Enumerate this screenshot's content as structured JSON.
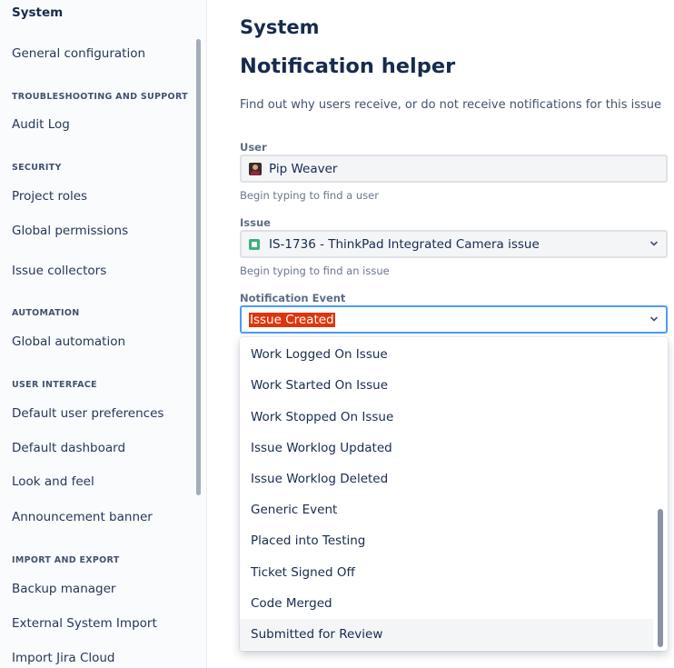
{
  "sidebar": {
    "top_item": "System",
    "items": [
      {
        "label": "General configuration"
      },
      {
        "label": "Audit Log"
      },
      {
        "label": "Project roles"
      },
      {
        "label": "Global permissions"
      },
      {
        "label": "Issue collectors"
      },
      {
        "label": "Global automation"
      },
      {
        "label": "Default user preferences"
      },
      {
        "label": "Default dashboard"
      },
      {
        "label": "Look and feel"
      },
      {
        "label": "Announcement banner"
      },
      {
        "label": "Backup manager"
      },
      {
        "label": "External System Import"
      },
      {
        "label": "Import Jira Cloud"
      }
    ],
    "sections": [
      "TROUBLESHOOTING AND SUPPORT",
      "SECURITY",
      "AUTOMATION",
      "USER INTERFACE",
      "IMPORT AND EXPORT"
    ]
  },
  "main": {
    "heading": "System",
    "title": "Notification helper",
    "description": "Find out why users receive, or do not receive notifications for this issue",
    "user": {
      "label": "User",
      "value": "Pip Weaver",
      "help": "Begin typing to find a user"
    },
    "issue": {
      "label": "Issue",
      "value": "IS-1736 - ThinkPad Integrated Camera issue",
      "help": "Begin typing to find an issue"
    },
    "event": {
      "label": "Notification Event",
      "value": "Issue Created"
    },
    "event_options": [
      "Work Logged On Issue",
      "Work Started On Issue",
      "Work Stopped On Issue",
      "Issue Worklog Updated",
      "Issue Worklog Deleted",
      "Generic Event",
      "Placed into Testing",
      "Ticket Signed Off",
      "Code Merged",
      "Submitted for Review"
    ]
  },
  "colors": {
    "accent": "#4c9aff",
    "selection": "#de350b",
    "story_icon": "#36b37e"
  }
}
